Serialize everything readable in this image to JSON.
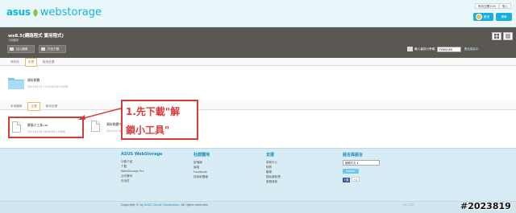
{
  "header": {
    "logo_asus": "asus",
    "logo_ws": "webstorage",
    "top_links": [
      "有效空間2GB",
      "登入"
    ],
    "user_button": "歡迎",
    "menu_button": "選單"
  },
  "titlebar": {
    "title": "ws8.5(網路程式 實用程式)",
    "subtitle": "1個檔案",
    "upload_label": "加入檔案",
    "download_label": "打包下載",
    "share_label": "輸入當前分享碼",
    "share_code": "YYWVUEK",
    "share_link": "連結複製中"
  },
  "folder_tabs": [
    "資料夾",
    "全選",
    "取消全選"
  ],
  "folder": {
    "name": "資料軟體",
    "meta": "2013-02-07 15:44:43.00 1900B"
  },
  "file_tabs": [
    "本地檔案",
    "全選",
    "取消全選"
  ],
  "files": [
    {
      "name": "解鎖小工具.rar",
      "meta": "2013-03-09 16:48:28 1.29MB"
    },
    {
      "name": "資料軟體介面_2.rar",
      "meta": "2013-02-06 13:58:24 1.19MB"
    }
  ],
  "callout": {
    "line1": "1.先下載\"解",
    "line2": "鎖小工具\""
  },
  "footer": {
    "columns": [
      {
        "title": "ASUS WebStorage",
        "links": [
          "功能介紹",
          "下載",
          "WebStorage Pro",
          "合作夥伴",
          "安全性"
        ]
      },
      {
        "title": "社群園地",
        "links": [
          "部落格",
          "論壇",
          "Facebook",
          "技術新聞報"
        ]
      },
      {
        "title": "支援",
        "links": [
          "幫助中心",
          "規則",
          "聯繫",
          "隱私權政策",
          "服務條款"
        ]
      }
    ],
    "lang_title": "語言與語言",
    "lang_selected": "繁體中文",
    "twitter": "twitter",
    "fb_like": "讚",
    "gplus": "+1",
    "copyright_prefix": "Copyright © by ",
    "copyright_link": "ASUS Cloud Corporation",
    "copyright_suffix": ". All rights reserved.",
    "version": "v3.1.45"
  },
  "watermark": "#2023819"
}
